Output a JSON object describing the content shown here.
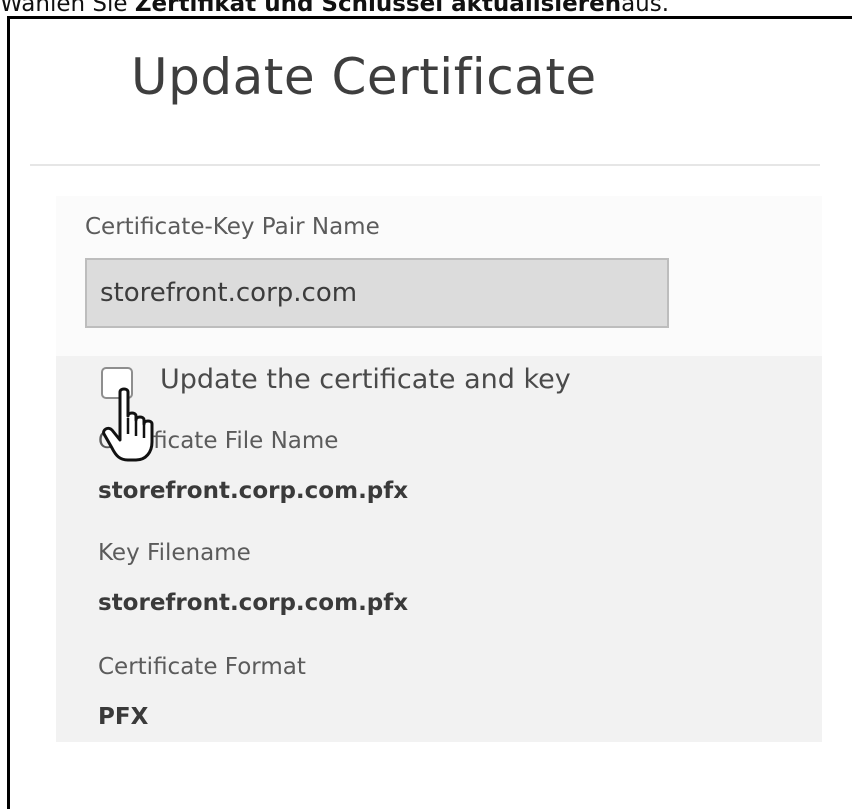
{
  "caption": {
    "prefix": "Wählen Sie ",
    "bold": "Zertifikat und Schlüssel aktualisieren",
    "suffix": "aus."
  },
  "dialog": {
    "title": "Update Certificate",
    "pair_name_label": "Certificate-Key Pair Name",
    "pair_name_value": "storefront.corp.com",
    "update_checkbox_label": "Update the certificate and key",
    "update_checkbox_checked": false,
    "cert_file_label": "Certificate File Name",
    "cert_file_value": "storefront.corp.com.pfx",
    "key_file_label": "Key Filename",
    "key_file_value": "storefront.corp.com.pfx",
    "cert_format_label": "Certificate Format",
    "cert_format_value": "PFX"
  },
  "icons": {
    "cursor": "hand-pointer-icon"
  }
}
